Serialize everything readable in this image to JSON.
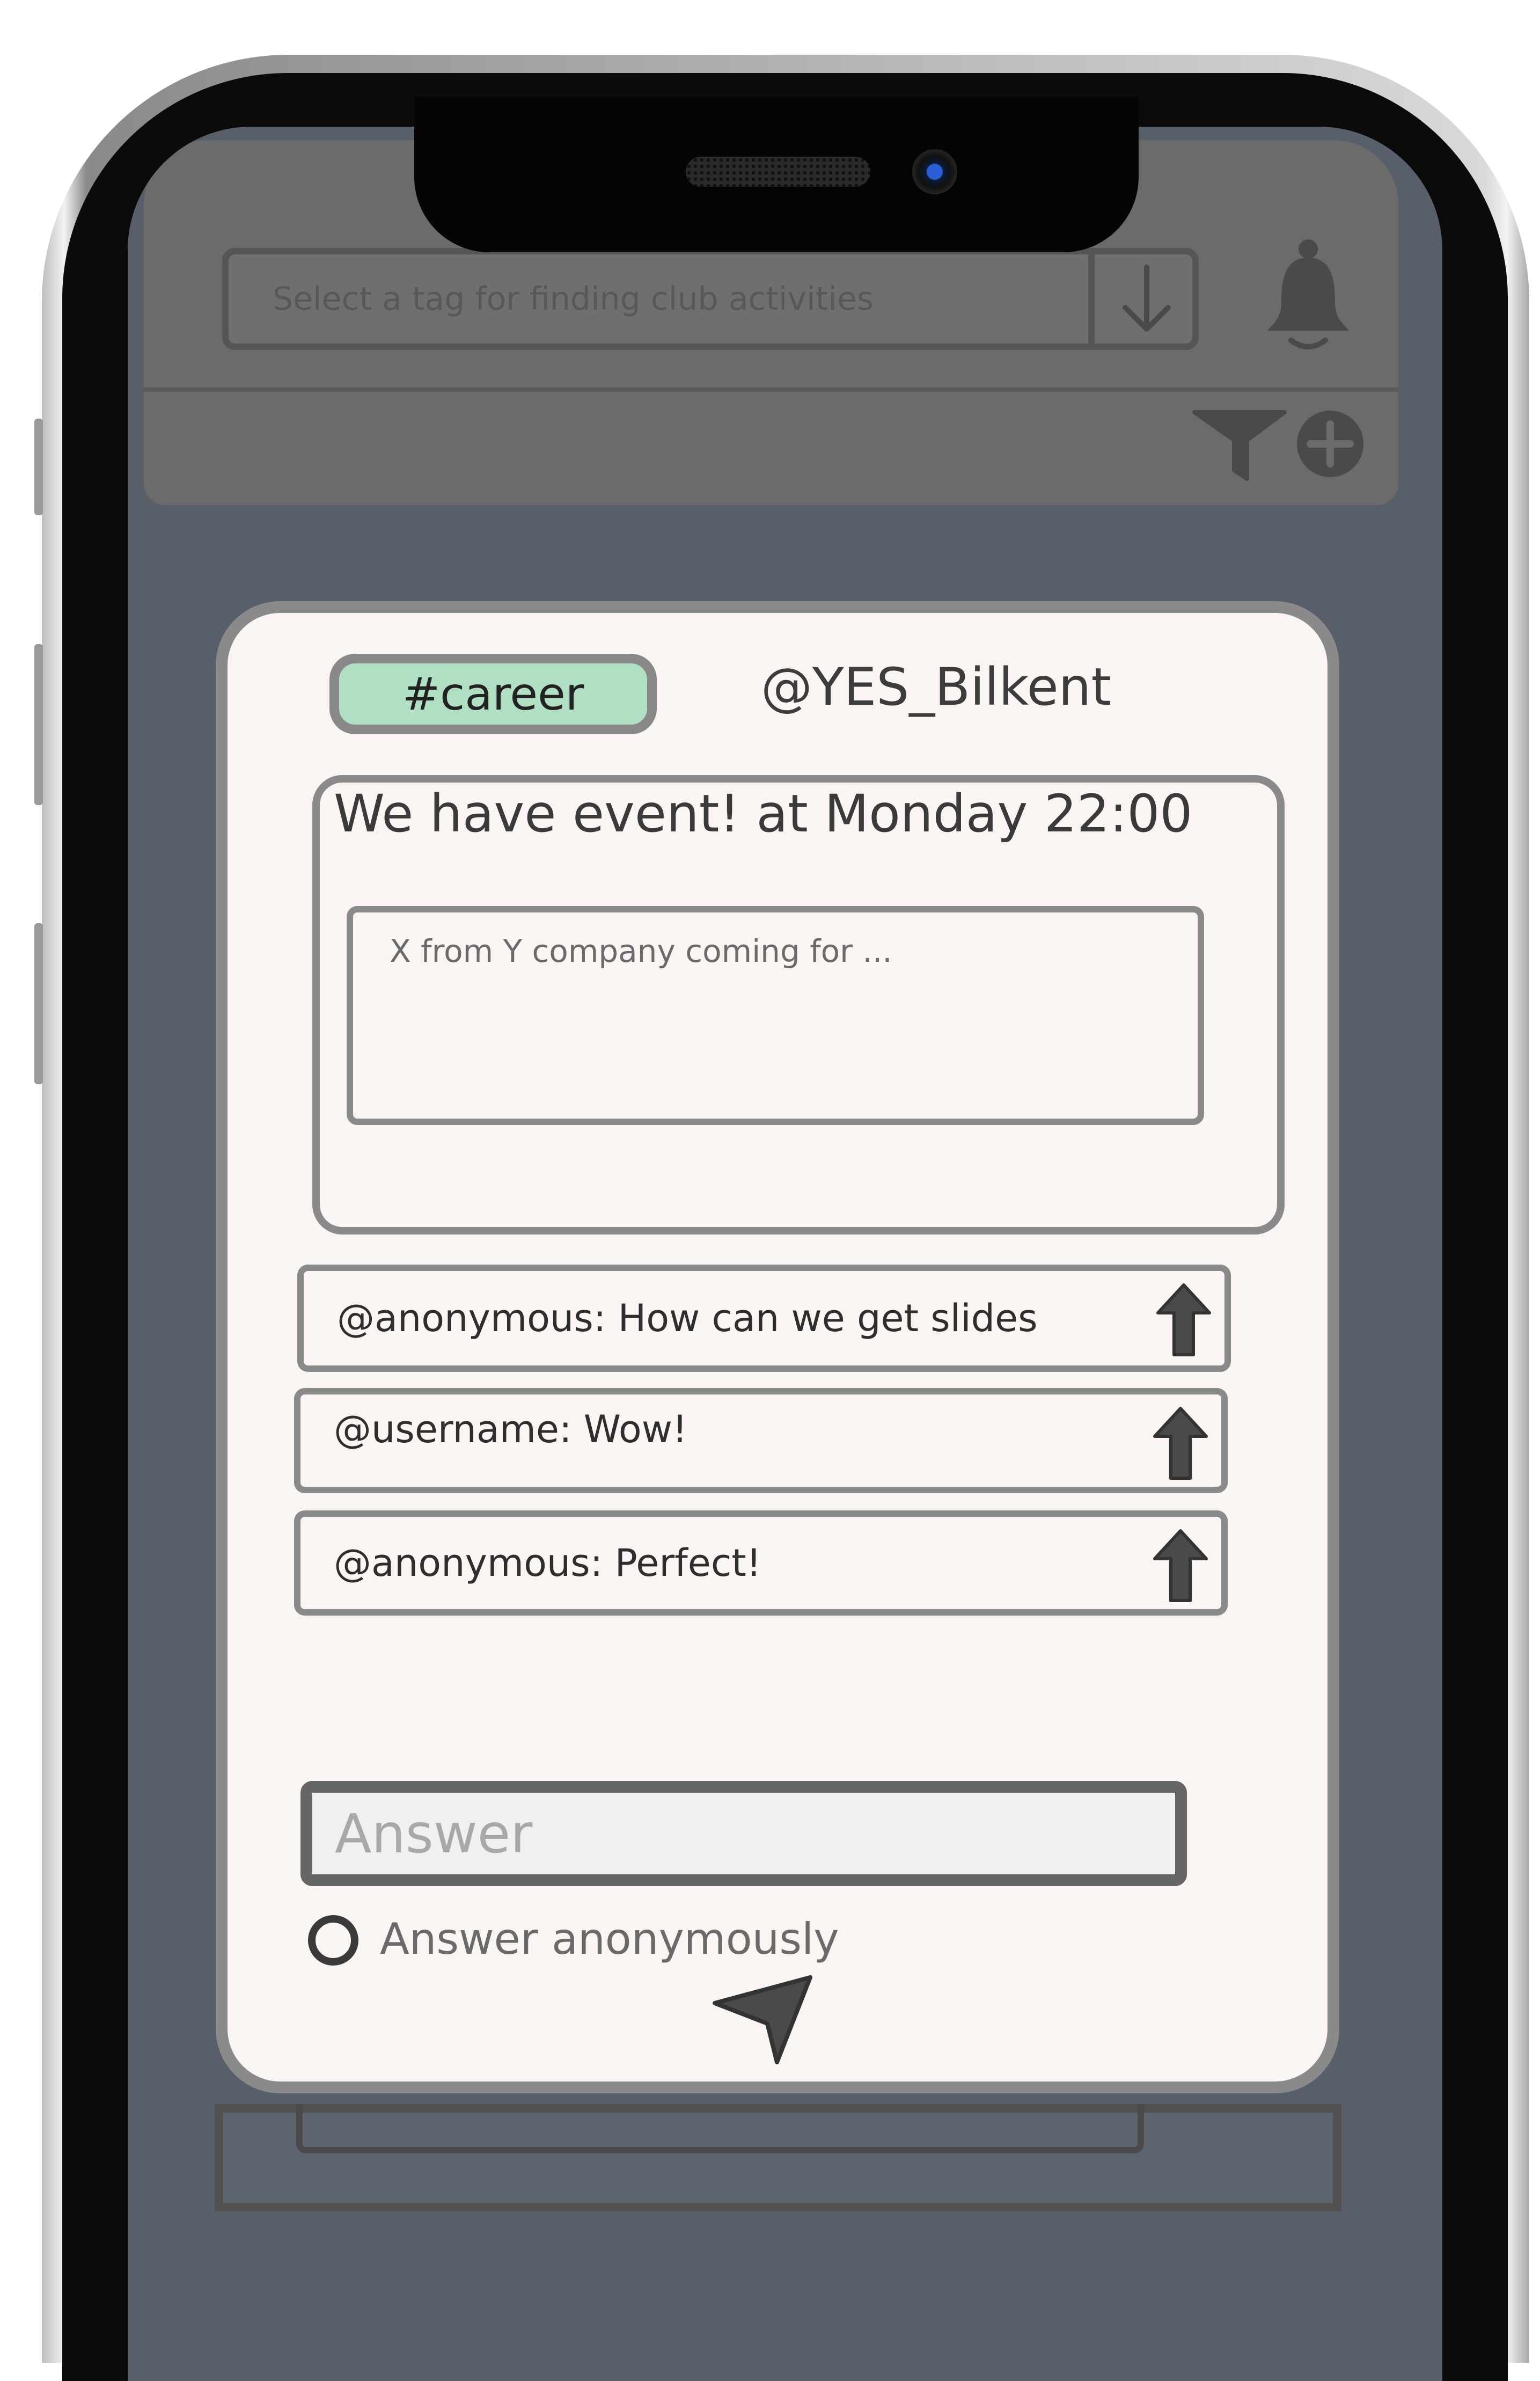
{
  "header": {
    "tag_select_placeholder": "Select a tag for finding club activities",
    "icons": {
      "dropdown": "down-arrow-icon",
      "notifications": "bell-icon",
      "filter": "filter-icon",
      "add": "plus-circle-icon"
    }
  },
  "post": {
    "tag": "#career",
    "club_handle": "@YES_Bilkent",
    "title": "We have event! at Monday 22:00",
    "description": "X from Y company coming for ..."
  },
  "comments": [
    {
      "text": "@anonymous: How can we get slides",
      "icon": "upvote-arrow-icon"
    },
    {
      "text": "@username: Wow!",
      "icon": "upvote-arrow-icon"
    },
    {
      "text": "@anonymous: Perfect!",
      "icon": "upvote-arrow-icon"
    }
  ],
  "reply": {
    "answer_placeholder": "Answer",
    "anonymous_label": "Answer anonymously",
    "send_icon": "send-icon"
  },
  "colors": {
    "screen_bg": "#595f6a",
    "card_bg": "#faf5f2",
    "tag_chip": "#b1dfc3",
    "border": "#8a8a8a"
  }
}
